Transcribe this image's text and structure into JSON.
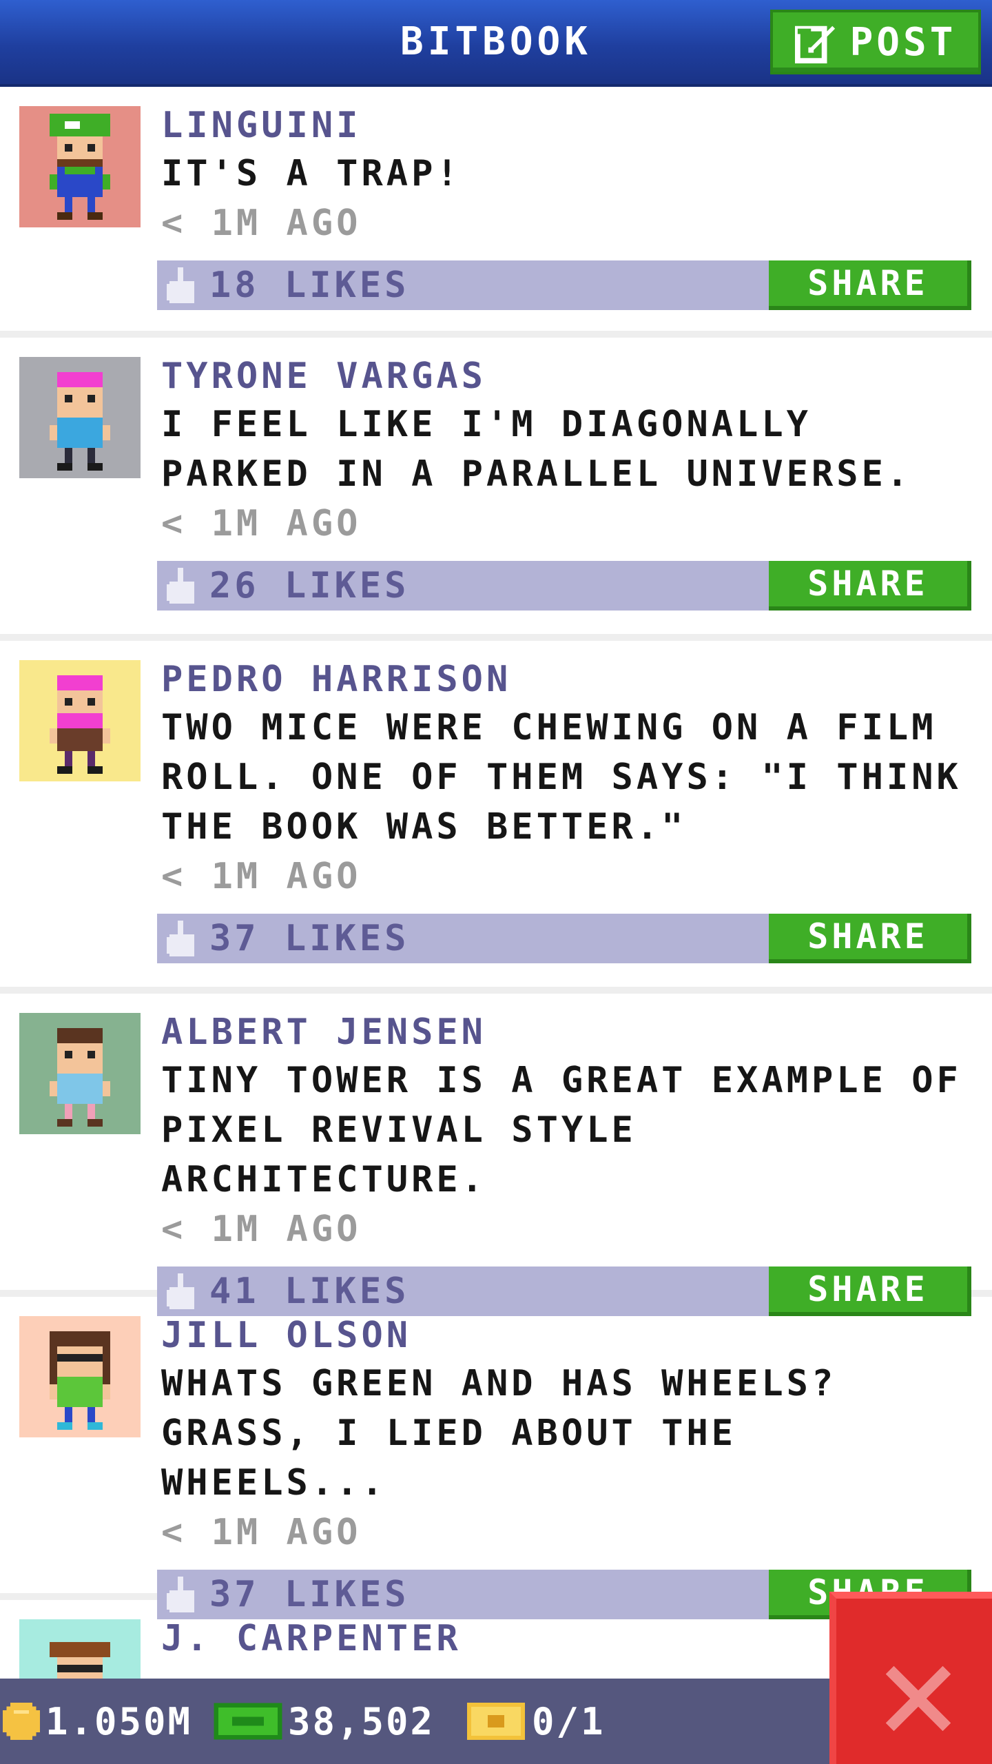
{
  "header": {
    "title": "BITBOOK",
    "post_label": "POST"
  },
  "feed": {
    "posts": [
      {
        "author": "LINGUINI",
        "message": "IT'S A TRAP!",
        "time": "< 1M AGO",
        "likes": "18 LIKES",
        "share_label": "SHARE",
        "avatar_bg": "#e58f86"
      },
      {
        "author": "TYRONE VARGAS",
        "message": "I FEEL LIKE I'M DIAGONALLY PARKED IN A PARALLEL UNIVERSE.",
        "time": "< 1M AGO",
        "likes": "26 LIKES",
        "share_label": "SHARE",
        "avatar_bg": "#a9aab0"
      },
      {
        "author": "PEDRO HARRISON",
        "message": "TWO MICE WERE CHEWING ON A FILM ROLL. ONE OF THEM SAYS: \"I THINK THE BOOK WAS BETTER.\"",
        "time": "< 1M AGO",
        "likes": "37 LIKES",
        "share_label": "SHARE",
        "avatar_bg": "#f9e88c"
      },
      {
        "author": "ALBERT JENSEN",
        "message": "TINY TOWER IS A GREAT EXAMPLE OF PIXEL REVIVAL STYLE ARCHITECTURE.",
        "time": "< 1M AGO",
        "likes": "41 LIKES",
        "share_label": "SHARE",
        "avatar_bg": "#86b290"
      },
      {
        "author": "JILL OLSON",
        "message": "WHATS GREEN AND HAS WHEELS? GRASS, I LIED ABOUT THE WHEELS...",
        "time": "< 1M AGO",
        "likes": "37 LIKES",
        "share_label": "SHARE",
        "avatar_bg": "#fdcfb8"
      },
      {
        "author": "J. CARPENTER",
        "avatar_bg": "#a7ebe0"
      }
    ]
  },
  "status_bar": {
    "coins": "1.050M",
    "bux": "38,502",
    "tickets": "0/1"
  },
  "colors": {
    "header": "#1f3f9f",
    "accent_green": "#3fae27",
    "likes_bar": "#b3b3d6",
    "author_text": "#57548e",
    "close_red": "#e02b2b"
  },
  "icons": [
    "edit-icon",
    "like-icon",
    "coin-icon",
    "bux-icon",
    "ticket-icon",
    "close-icon"
  ]
}
